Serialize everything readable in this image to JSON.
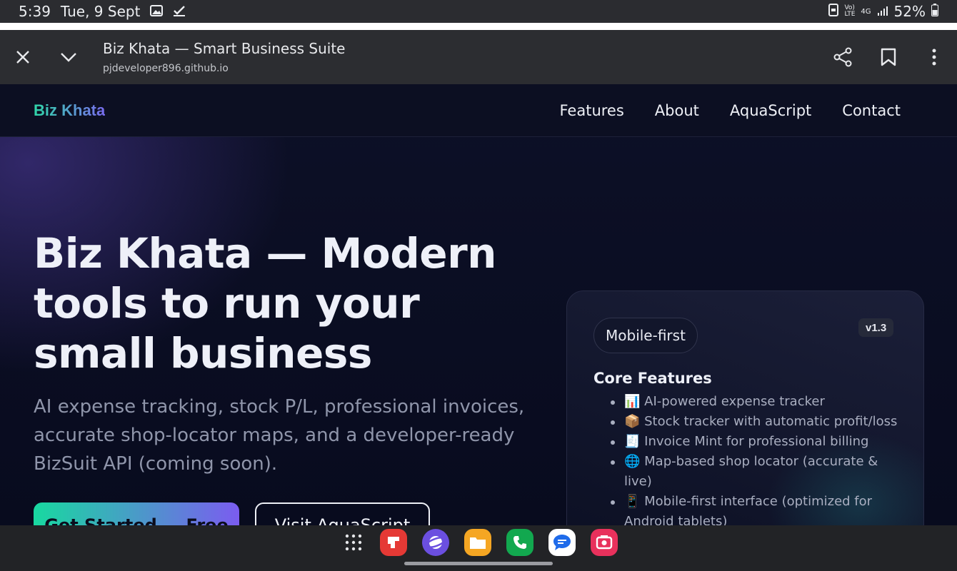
{
  "status_bar": {
    "time": "5:39",
    "date": "Tue, 9 Sept",
    "network_top": "Vo)",
    "network_bottom": "LTE",
    "gen": "4G",
    "battery": "52%"
  },
  "browser": {
    "title": "Biz Khata — Smart Business Suite",
    "url": "pjdeveloper896.github.io"
  },
  "site": {
    "brand": "Biz Khata",
    "nav": [
      "Features",
      "About",
      "AquaScript",
      "Contact"
    ],
    "hero_title": "Biz Khata — Modern tools to run your small business",
    "hero_sub": "AI expense tracking, stock P/L, professional invoices, accurate shop-locator maps, and a developer-ready BizSuit API (coming soon).",
    "cta_primary": "Get Started — Free",
    "cta_secondary": "Visit AquaScript",
    "card": {
      "pill": "Mobile-first",
      "version": "v1.3",
      "heading": "Core Features",
      "features": [
        "📊 AI-powered expense tracker",
        "📦 Stock tracker with automatic profit/loss",
        "🧾 Invoice Mint for professional billing",
        "🌐 Map-based shop locator (accurate & live)",
        "📱 Mobile-first interface (optimized for Android tablets)"
      ]
    }
  },
  "taskbar": {
    "apps": [
      "apps-grid-icon",
      "flipboard-icon",
      "internet-browser-icon",
      "my-files-icon",
      "phone-icon",
      "messages-icon",
      "screen-recorder-icon"
    ]
  },
  "colors": {
    "accent_start": "#18d9a0",
    "accent_end": "#7b5cf0",
    "site_bg": "#0b0e22"
  }
}
